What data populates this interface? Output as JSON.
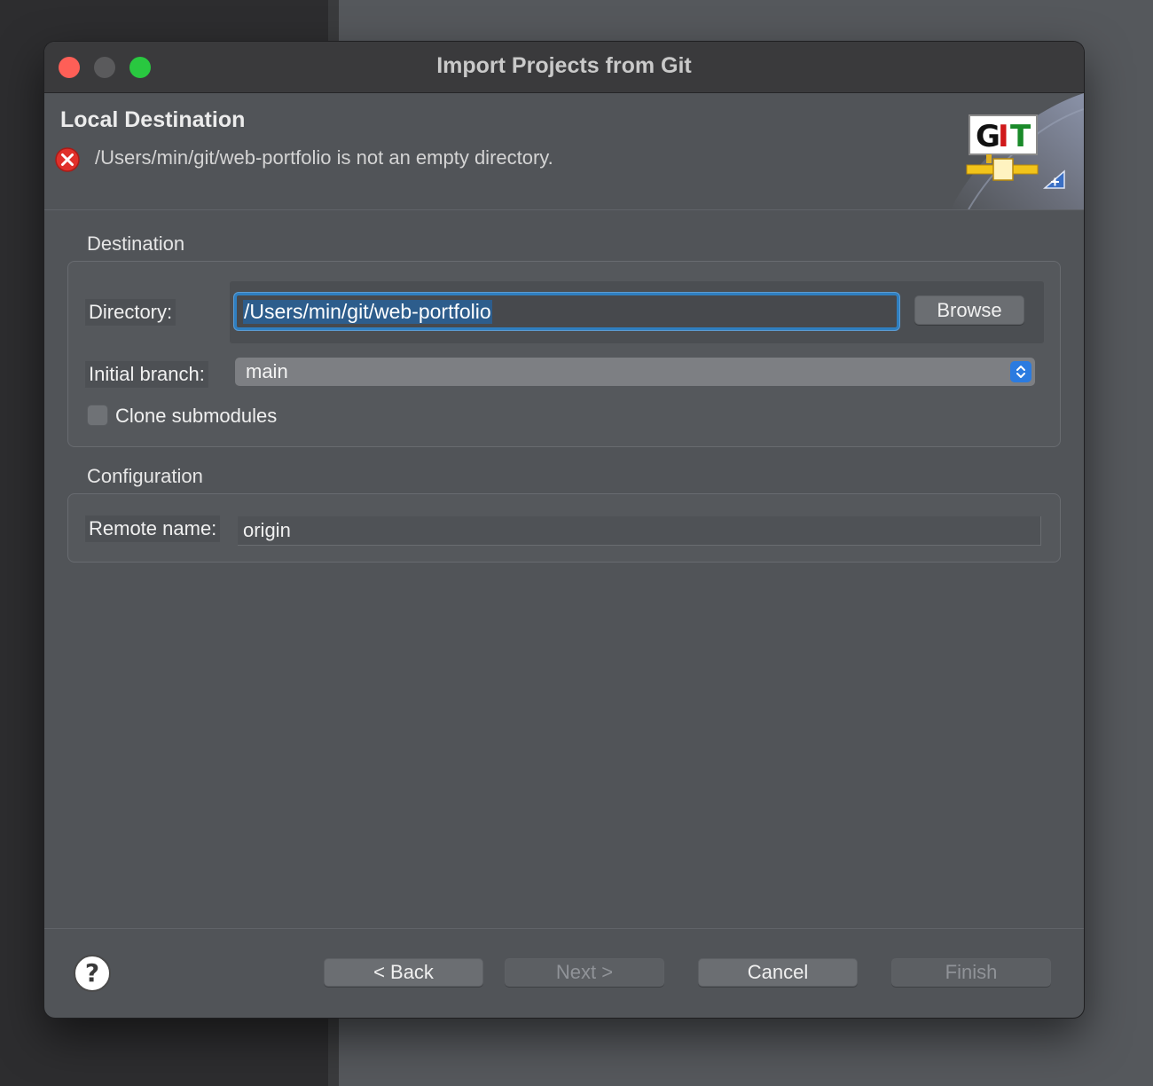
{
  "window": {
    "title": "Import Projects from Git"
  },
  "header": {
    "title": "Local Destination",
    "error_message": "/Users/min/git/web-portfolio is not an empty directory.",
    "banner_text": "GIT"
  },
  "destination": {
    "section_label": "Destination",
    "directory_label": "Directory:",
    "directory_value": "/Users/min/git/web-portfolio",
    "browse_label": "Browse",
    "branch_label": "Initial branch:",
    "branch_value": "main",
    "clone_submodules_label": "Clone submodules",
    "clone_submodules_checked": false
  },
  "configuration": {
    "section_label": "Configuration",
    "remote_label": "Remote name:",
    "remote_value": "origin"
  },
  "footer": {
    "help_label": "?",
    "back_label": "< Back",
    "next_label": "Next >",
    "cancel_label": "Cancel",
    "finish_label": "Finish"
  },
  "colors": {
    "focus_ring": "#2f7fc1",
    "error_red": "#e0302a",
    "close_light": "#fe5f57",
    "zoom_light": "#29c840"
  }
}
